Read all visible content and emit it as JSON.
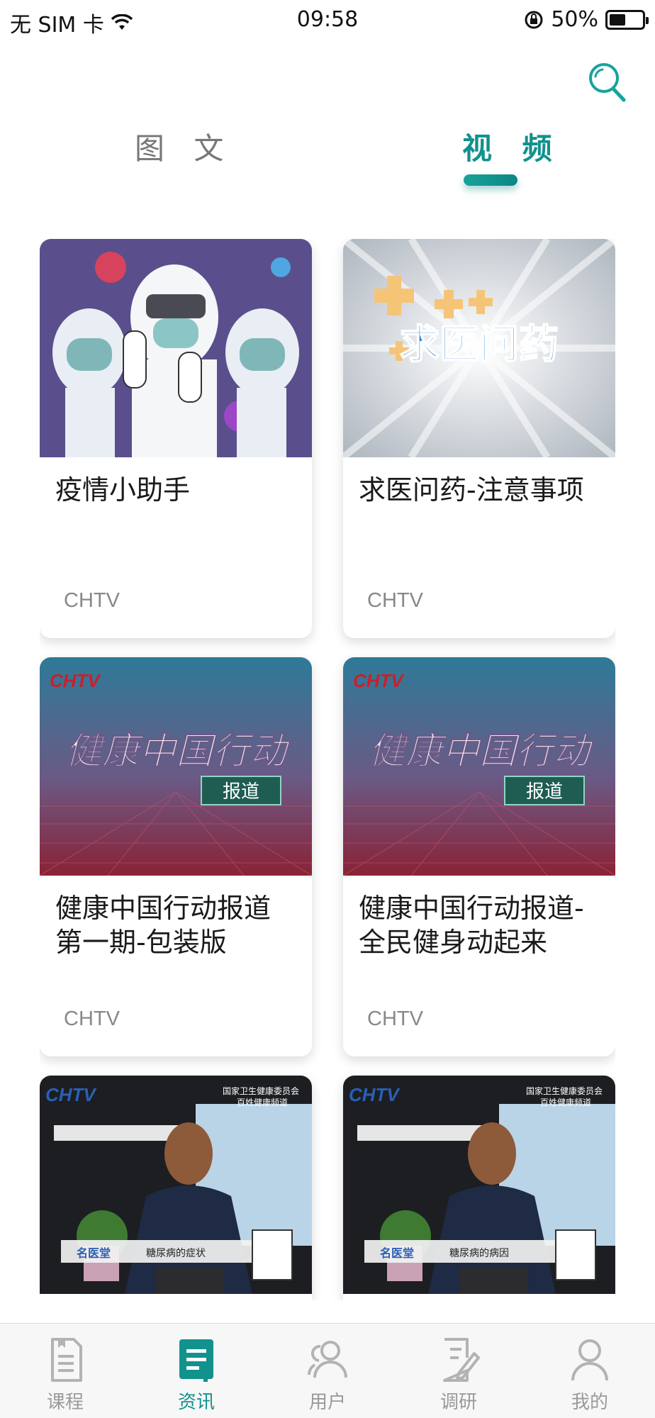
{
  "status_bar": {
    "carrier": "无 SIM 卡",
    "time": "09:58",
    "battery": "50%",
    "battery_level": 0.5
  },
  "search": {
    "icon": "search-icon"
  },
  "tabs": [
    {
      "label": "图 文",
      "active": false
    },
    {
      "label": "视 频",
      "active": true
    }
  ],
  "cards": [
    {
      "title": "疫情小助手",
      "source": "CHTV"
    },
    {
      "title": "求医问药-注意事项",
      "source": "CHTV",
      "thumb_logo": "求医问药"
    },
    {
      "title": "健康中国行动报道第一期-包装版",
      "source": "CHTV",
      "thumb_logo": "CHTV",
      "thumb_title": "健康中国行动",
      "thumb_badge": "报道"
    },
    {
      "title": "健康中国行动报道-全民健身动起来",
      "source": "CHTV",
      "thumb_logo": "CHTV",
      "thumb_title": "健康中国行动",
      "thumb_badge": "报道"
    },
    {
      "title": "",
      "source": "",
      "thumb_logo": "CHTV",
      "thumb_org": "国家卫生健康委员会",
      "thumb_org2": "百姓健康频道",
      "thumb_show": "名医堂",
      "thumb_caption": "糖尿病的症状"
    },
    {
      "title": "",
      "source": "",
      "thumb_logo": "CHTV",
      "thumb_org": "国家卫生健康委员会",
      "thumb_org2": "百姓健康频道",
      "thumb_show": "名医堂",
      "thumb_caption": "糖尿病的病因"
    }
  ],
  "bottom_nav": [
    {
      "label": "课程",
      "icon": "course-icon",
      "active": false
    },
    {
      "label": "资讯",
      "icon": "news-icon",
      "active": true
    },
    {
      "label": "用户",
      "icon": "users-icon",
      "active": false
    },
    {
      "label": "调研",
      "icon": "survey-icon",
      "active": false
    },
    {
      "label": "我的",
      "icon": "profile-icon",
      "active": false
    }
  ],
  "colors": {
    "accent": "#12918d",
    "inactive": "#9a9a9a"
  }
}
